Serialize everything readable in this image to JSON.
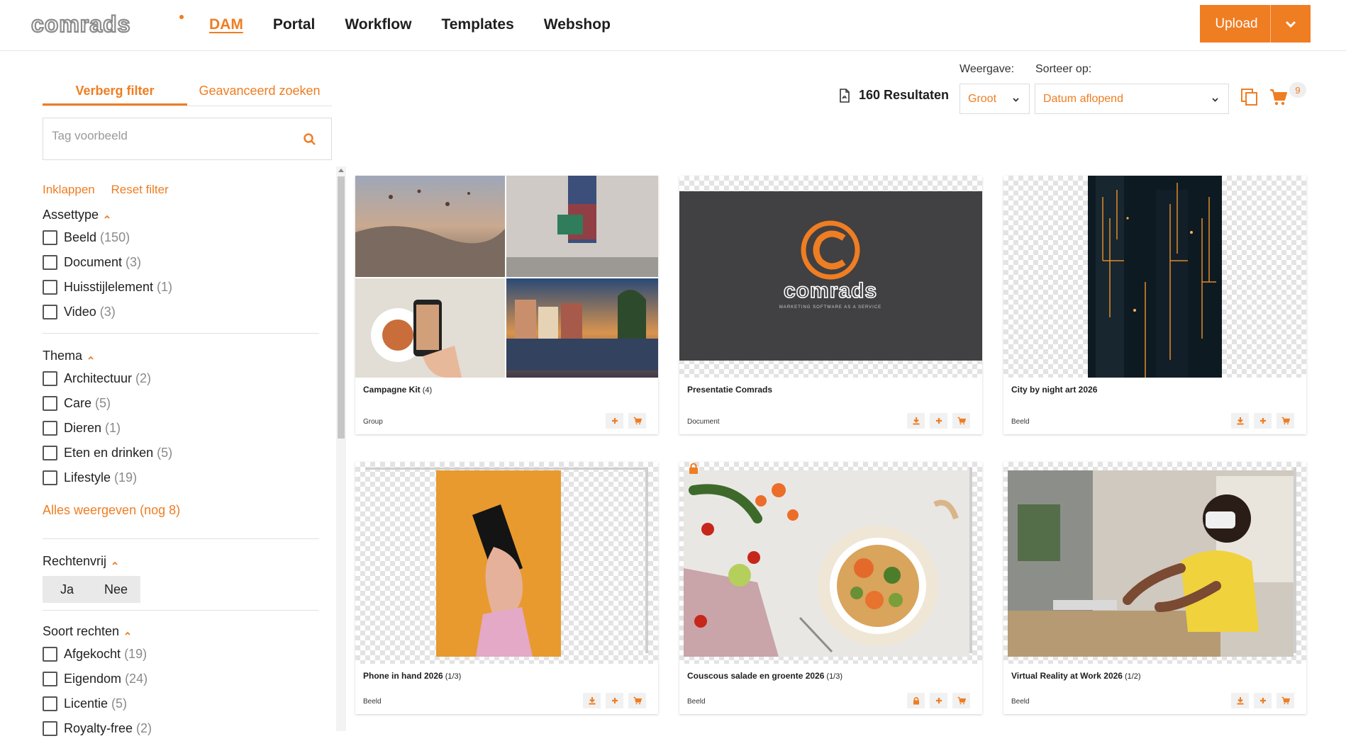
{
  "header": {
    "logo_text": "comrads",
    "nav": [
      {
        "label": "DAM",
        "active": true
      },
      {
        "label": "Portal",
        "active": false
      },
      {
        "label": "Workflow",
        "active": false
      },
      {
        "label": "Templates",
        "active": false
      },
      {
        "label": "Webshop",
        "active": false
      }
    ],
    "upload_label": "Upload",
    "accent_color": "#ef7d22"
  },
  "sidebar": {
    "tab_hide_filter": "Verberg filter",
    "tab_advanced_search": "Geavanceerd zoeken",
    "search_placeholder": "Tag voorbeeld",
    "collapse_label": "Inklappen",
    "reset_label": "Reset filter",
    "groups": {
      "assettype": {
        "title": "Assettype",
        "options": [
          {
            "label": "Beeld",
            "count": "(150)"
          },
          {
            "label": "Document",
            "count": "(3)"
          },
          {
            "label": "Huisstijlelement",
            "count": "(1)"
          },
          {
            "label": "Video",
            "count": "(3)"
          }
        ]
      },
      "thema": {
        "title": "Thema",
        "options": [
          {
            "label": "Architectuur",
            "count": "(2)"
          },
          {
            "label": "Care",
            "count": "(5)"
          },
          {
            "label": "Dieren",
            "count": "(1)"
          },
          {
            "label": "Eten en drinken",
            "count": "(5)"
          },
          {
            "label": "Lifestyle",
            "count": "(19)"
          }
        ],
        "show_all": "Alles weergeven (nog 8)"
      },
      "rechtenvrij": {
        "title": "Rechtenvrij",
        "yes": "Ja",
        "no": "Nee"
      },
      "soort_rechten": {
        "title": "Soort rechten",
        "options": [
          {
            "label": "Afgekocht",
            "count": "(19)"
          },
          {
            "label": "Eigendom",
            "count": "(24)"
          },
          {
            "label": "Licentie",
            "count": "(5)"
          },
          {
            "label": "Royalty-free",
            "count": "(2)"
          }
        ]
      }
    }
  },
  "toolbar": {
    "results": "160 Resultaten",
    "weergave_label": "Weergave:",
    "weergave_value": "Groot",
    "sort_label": "Sorteer op:",
    "sort_value": "Datum aflopend",
    "cart_count": "9"
  },
  "cards": [
    {
      "title": "Campagne Kit",
      "sub": "(4)",
      "type": "Group",
      "actions": [
        "plus-icon",
        "cart-icon"
      ]
    },
    {
      "title": "Presentatie Comrads",
      "sub": "",
      "type": "Document",
      "actions": [
        "download-icon",
        "plus-icon",
        "cart-icon"
      ],
      "logo_text": "comrads",
      "logo_tagline": "MARKETING SOFTWARE AS A SERVICE"
    },
    {
      "title": "City by night art 2026",
      "sub": "",
      "type": "Beeld",
      "actions": [
        "download-icon",
        "plus-icon",
        "cart-icon"
      ]
    },
    {
      "title": "Phone in hand 2026",
      "sub": "(1/3)",
      "type": "Beeld",
      "actions": [
        "download-icon",
        "plus-icon",
        "cart-icon"
      ]
    },
    {
      "title": "Couscous salade en groente 2026",
      "sub": "(1/3)",
      "type": "Beeld",
      "actions": [
        "lock-icon",
        "plus-icon",
        "cart-icon"
      ]
    },
    {
      "title": "Virtual Reality at Work 2026",
      "sub": "(1/2)",
      "type": "Beeld",
      "actions": [
        "download-icon",
        "plus-icon",
        "cart-icon"
      ]
    }
  ]
}
